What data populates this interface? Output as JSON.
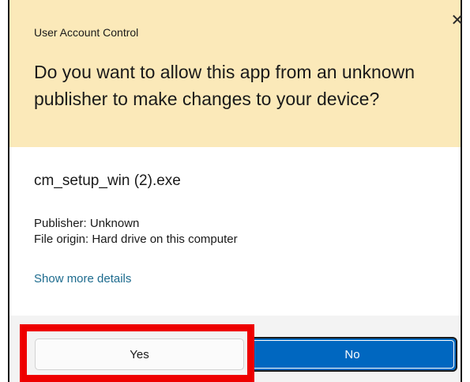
{
  "dialog": {
    "title": "User Account Control",
    "close_glyph": "✕",
    "question": "Do you want to allow this app from an unknown publisher to make changes to your device?",
    "app_name": "cm_setup_win (2).exe",
    "publisher": "Publisher: Unknown",
    "file_origin": "File origin: Hard drive on this computer",
    "details_link": "Show more details"
  },
  "buttons": {
    "yes_label": "Yes",
    "no_label": "No"
  },
  "colors": {
    "header_bg": "#fbe9b9",
    "footer_bg": "#f3f3f3",
    "primary_button": "#0067c0",
    "link": "#1d6b8e",
    "highlight": "#ee0000"
  },
  "icons": {
    "close": "close-icon"
  }
}
